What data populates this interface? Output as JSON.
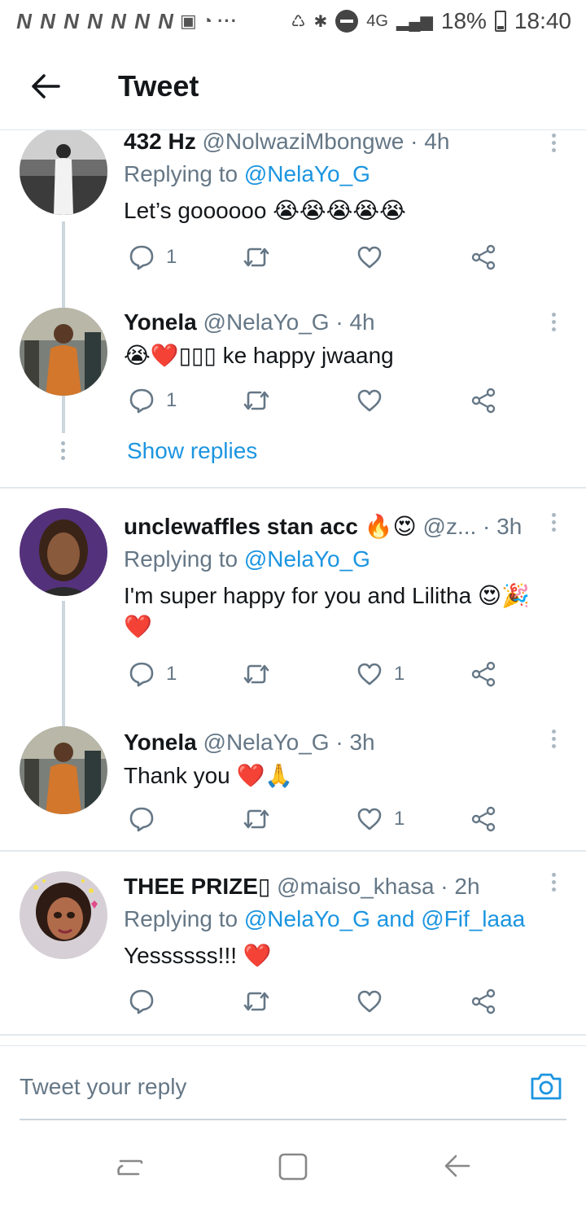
{
  "status_bar": {
    "notification_letters": [
      "N",
      "N",
      "N",
      "N",
      "N",
      "N",
      "N"
    ],
    "network": "4G",
    "battery": "18%",
    "time": "18:40"
  },
  "header": {
    "back_icon": "arrow-left-icon",
    "title": "Tweet"
  },
  "tweets": [
    {
      "name": "432 Hz",
      "handle": "@NolwaziMbongwe · 4h",
      "reply_prefix": "Replying to ",
      "reply_to": "@NelaYo_G",
      "text": "Let’s goooooo 😭😭😭😭😭",
      "reply_count": "1",
      "like_count": ""
    },
    {
      "name": "Yonela",
      "handle": "@NelaYo_G · 4h",
      "text": "😭❤️▯▯▯ ke happy jwaang",
      "reply_count": "1",
      "like_count": "",
      "show_replies": "Show replies"
    },
    {
      "name": "unclewaffles stan acc 🔥😍",
      "handle": "@z... · 3h",
      "reply_prefix": "Replying to ",
      "reply_to": "@NelaYo_G",
      "text": "I'm super happy for you and Lilitha 😍🎉❤️",
      "reply_count": "1",
      "like_count": "1"
    },
    {
      "name": "Yonela",
      "handle": "@NelaYo_G · 3h",
      "text": "Thank you ❤️🙏",
      "reply_count": "",
      "like_count": "1"
    },
    {
      "name": "THEE PRIZE▯",
      "handle": "@maiso_khasa · 2h",
      "reply_prefix": "Replying to ",
      "reply_to": "@NelaYo_G and @Fif_laaa",
      "text": "Yessssss!!! ❤️",
      "reply_count": "",
      "like_count": ""
    }
  ],
  "composer": {
    "placeholder": "Tweet your reply",
    "camera_icon": "camera-icon"
  },
  "colors": {
    "link": "#1b95e0",
    "muted": "#657786",
    "text": "#14171a",
    "divider": "#e1e8ed"
  }
}
